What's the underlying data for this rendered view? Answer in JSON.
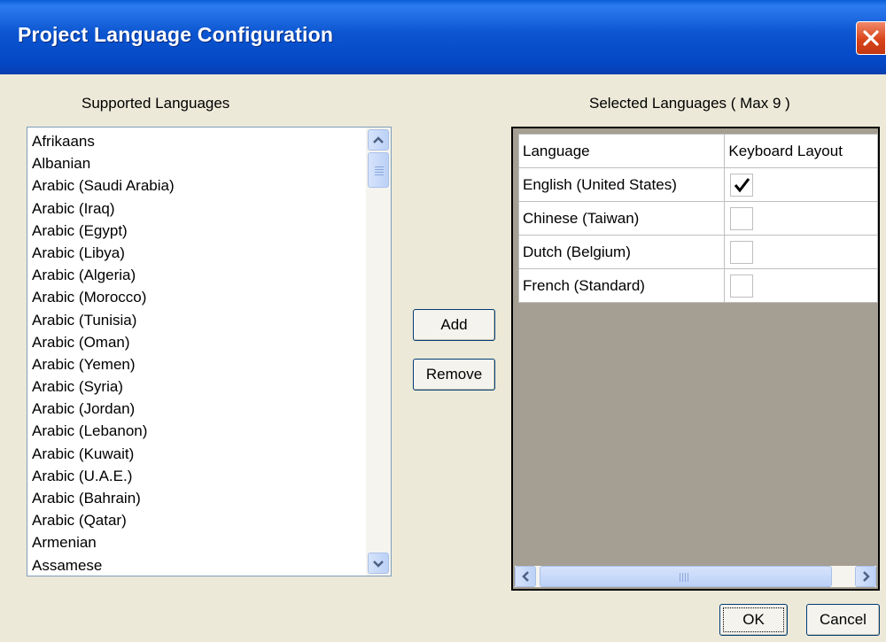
{
  "window": {
    "title": "Project Language Configuration"
  },
  "supported": {
    "label": "Supported Languages",
    "items": [
      "Afrikaans",
      "Albanian",
      "Arabic (Saudi Arabia)",
      "Arabic (Iraq)",
      "Arabic (Egypt)",
      "Arabic (Libya)",
      "Arabic (Algeria)",
      "Arabic (Morocco)",
      "Arabic (Tunisia)",
      "Arabic (Oman)",
      "Arabic (Yemen)",
      "Arabic (Syria)",
      "Arabic (Jordan)",
      "Arabic (Lebanon)",
      "Arabic (Kuwait)",
      "Arabic (U.A.E.)",
      "Arabic (Bahrain)",
      "Arabic (Qatar)",
      "Armenian",
      "Assamese"
    ]
  },
  "buttons": {
    "add": "Add",
    "remove": "Remove",
    "ok": "OK",
    "cancel": "Cancel"
  },
  "selected": {
    "label": "Selected Languages ( Max 9 )",
    "columns": [
      "Language",
      "Keyboard Layout"
    ],
    "rows": [
      {
        "language": "English (United States)",
        "keyboard": true
      },
      {
        "language": "Chinese (Taiwan)",
        "keyboard": false
      },
      {
        "language": "Dutch (Belgium)",
        "keyboard": false
      },
      {
        "language": "French (Standard)",
        "keyboard": false
      }
    ]
  },
  "colors": {
    "titlebar": "#0447c6",
    "dialog_bg": "#ece9d8",
    "grid_empty": "#a59e92",
    "close": "#d9441a"
  }
}
